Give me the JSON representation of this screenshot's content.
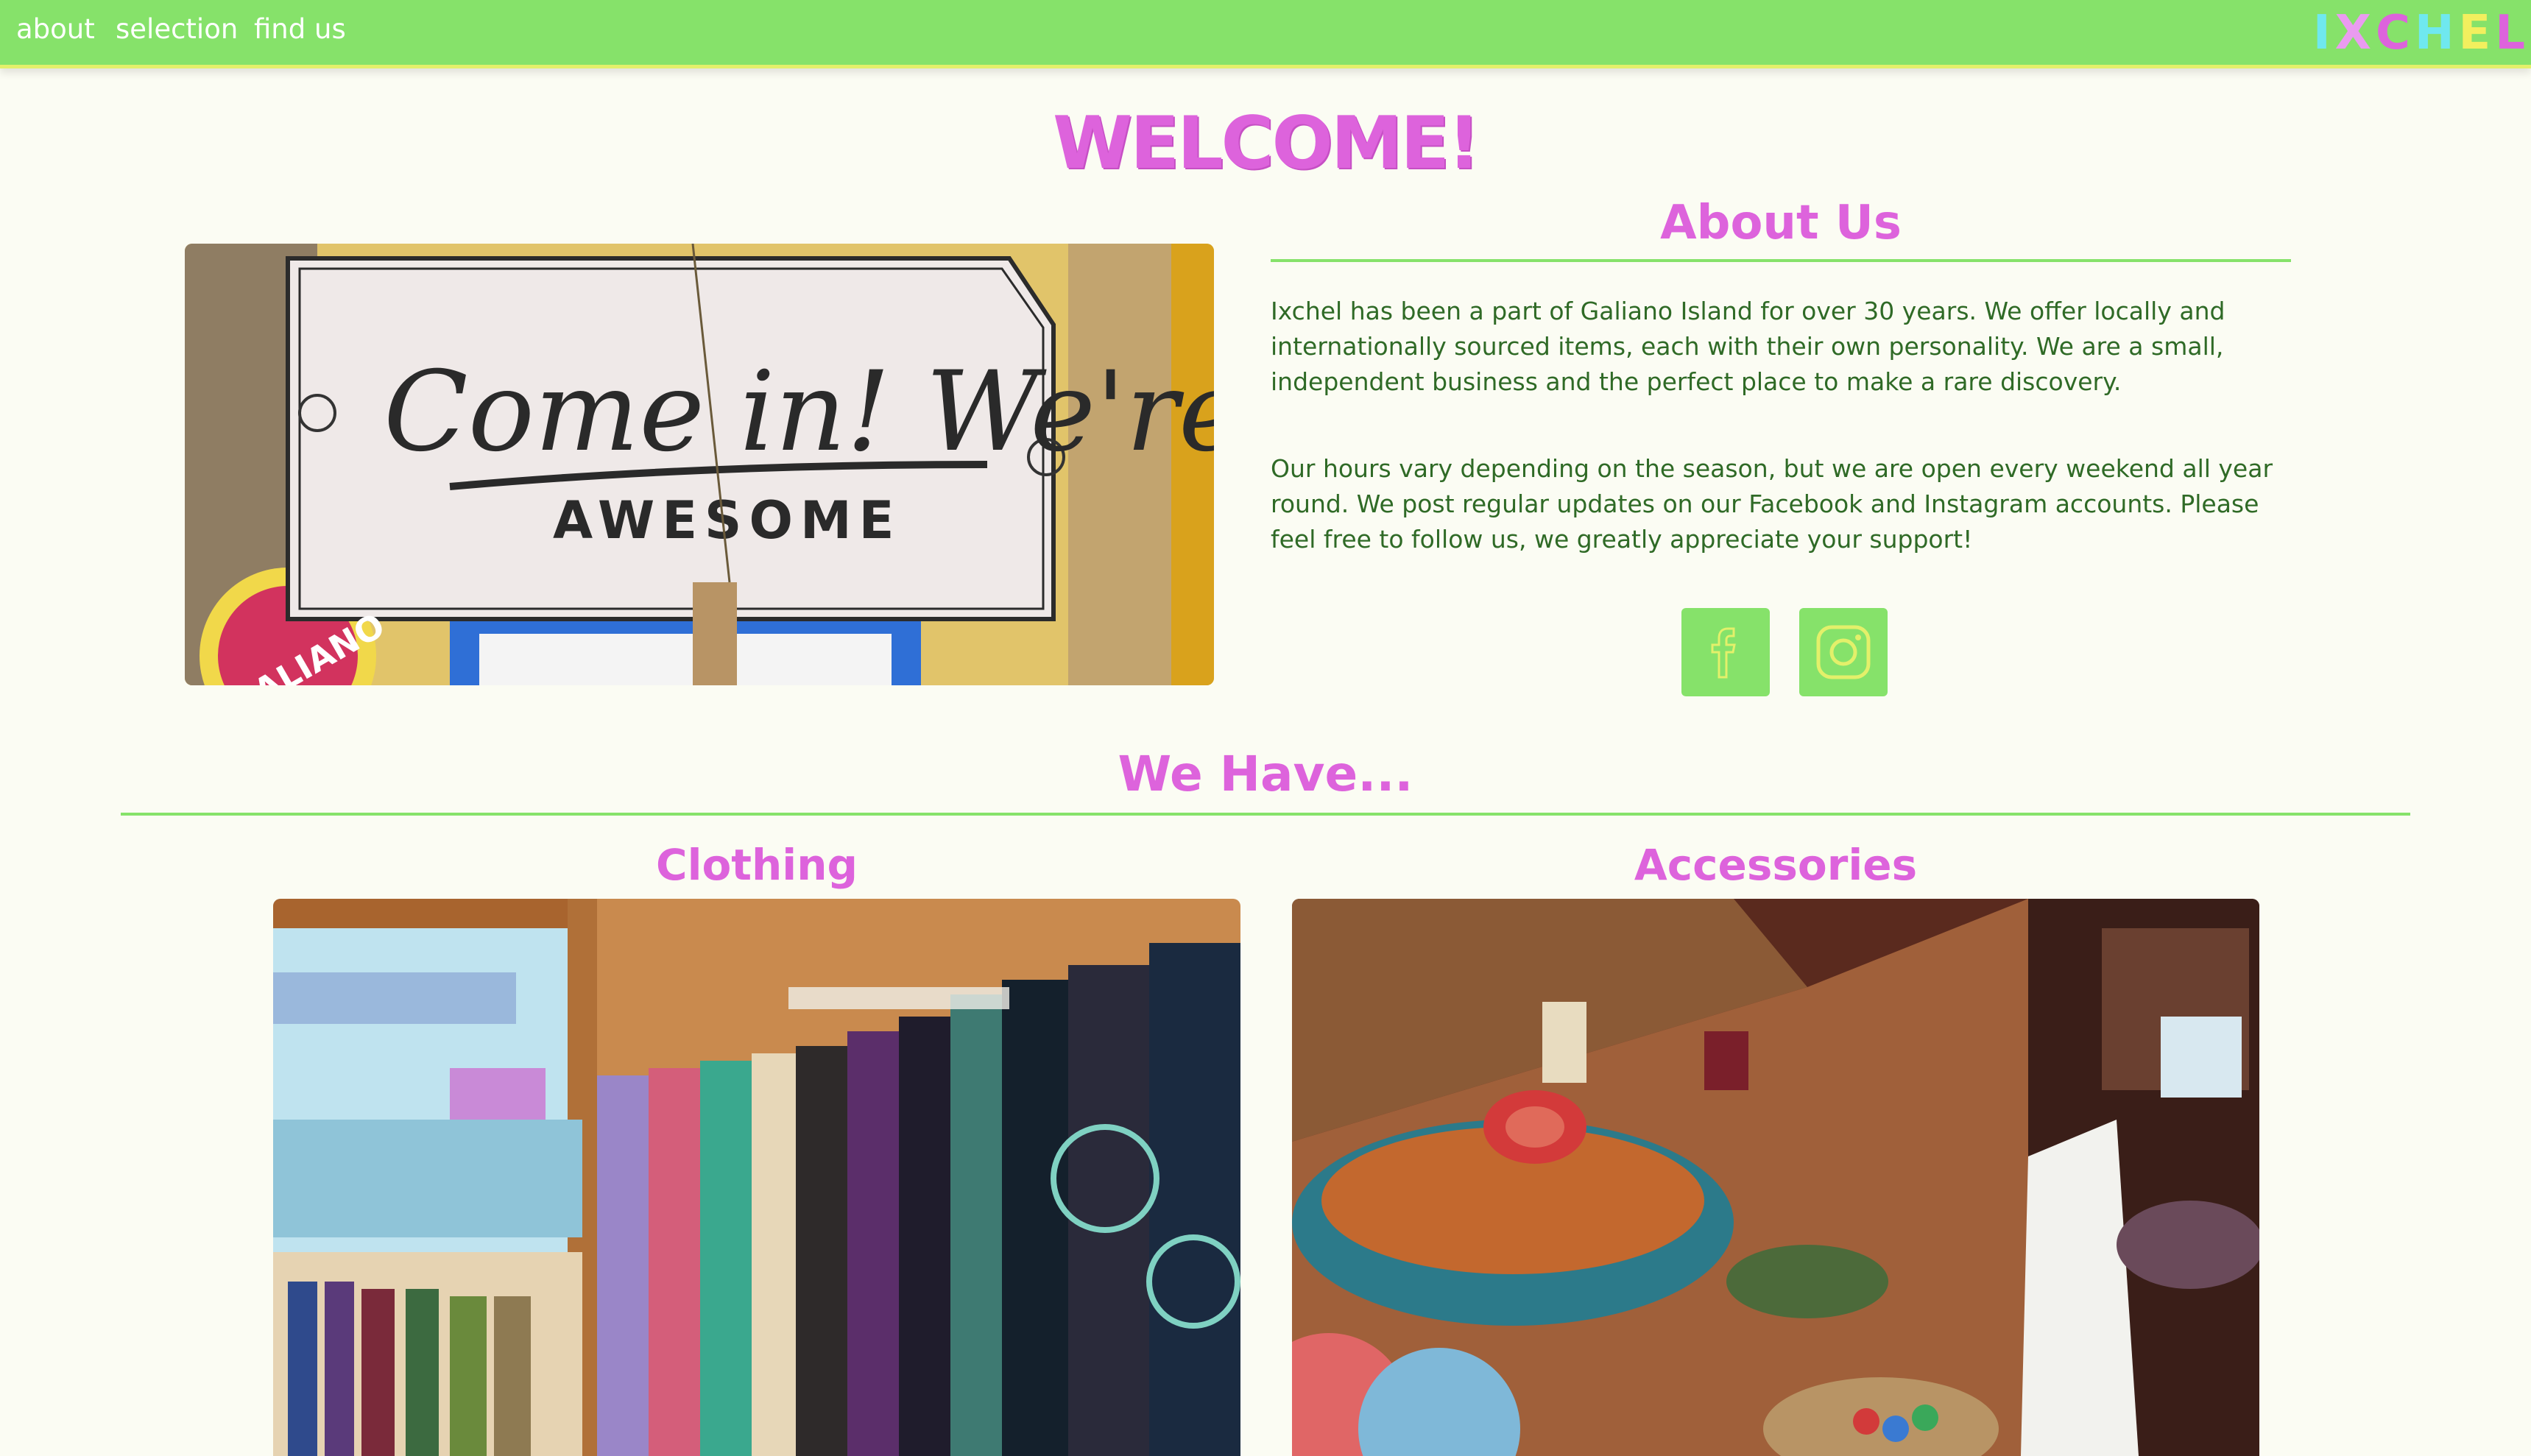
{
  "nav": {
    "links": [
      "about",
      "selection",
      "find us"
    ],
    "logo_letters": [
      "I",
      "X",
      "C",
      "H",
      "E",
      "L"
    ],
    "logo_colors": [
      "#6fe8ef",
      "#ea9bf0",
      "#dd63dc",
      "#6fe8ef",
      "#f2ef5e",
      "#dd63dc"
    ]
  },
  "welcome": "WELCOME!",
  "about": {
    "title": "About Us",
    "paragraph1": "Ixchel has been a part of Galiano Island for over 30 years. We offer locally and internationally sourced items, each with their own personality. We are a small, independent business and the perfect place to make a rare discovery.",
    "paragraph2": "Our hours vary depending on the season, but we are open every weekend all year round. We post regular updates on our Facebook and Instagram accounts. Please feel free to follow us, we greatly appreciate your support!"
  },
  "sign_photo": {
    "line1": "Come in! We're",
    "line2": "AWESOME",
    "sticker": "GALIANO"
  },
  "social": {
    "facebook_icon": "facebook-icon",
    "instagram_icon": "instagram-icon"
  },
  "we_have": {
    "title": "We Have...",
    "categories": [
      "Clothing",
      "Accessories"
    ]
  },
  "colors": {
    "accent_green": "#86e26a",
    "heading_pink": "#dd63dc",
    "body_text": "#2f6a26",
    "page_bg": "#fbfcf3"
  }
}
